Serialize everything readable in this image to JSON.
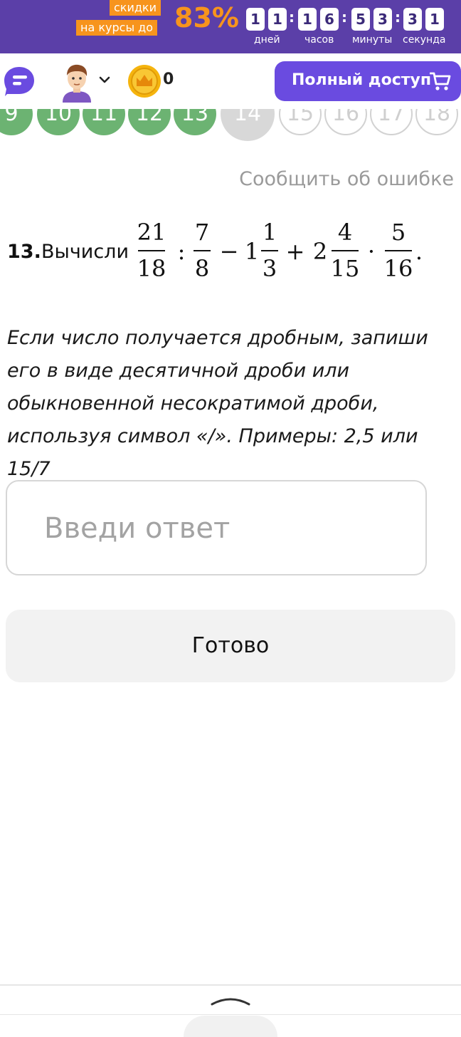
{
  "promo": {
    "label_line1": "скидки",
    "label_line2": "на курсы до",
    "percent": "83%",
    "timer": {
      "days": [
        "1",
        "1"
      ],
      "hours": [
        "1",
        "6"
      ],
      "minutes": [
        "5",
        "3"
      ],
      "seconds": [
        "3",
        "1"
      ],
      "separator": ":",
      "unit_days": "дней",
      "unit_hours": "часов",
      "unit_minutes": "минуты",
      "unit_seconds": "секунда"
    }
  },
  "header": {
    "coins": "0",
    "access_button": "Полный доступ",
    "icons": [
      "chat-icon",
      "avatar",
      "chevron-down-icon",
      "coin-icon",
      "cart-icon"
    ]
  },
  "pager": {
    "pages": [
      "9",
      "10",
      "11",
      "12",
      "13",
      "14",
      "15",
      "16",
      "17",
      "18"
    ],
    "done": [
      "9",
      "10",
      "11",
      "12",
      "13"
    ],
    "current": "14",
    "todo": [
      "15",
      "16",
      "17",
      "18"
    ]
  },
  "task": {
    "report_link": "Сообщить об ошибке",
    "number": "13.",
    "verb": "Вычисли",
    "expression": {
      "frac1": {
        "num": "21",
        "den": "18"
      },
      "op1": ":",
      "frac2": {
        "num": "7",
        "den": "8"
      },
      "op2": "−",
      "mixed1": {
        "whole": "1",
        "num": "1",
        "den": "3"
      },
      "op3": "+",
      "mixed2": {
        "whole": "2",
        "num": "4",
        "den": "15"
      },
      "op4": "·",
      "frac3": {
        "num": "5",
        "den": "16"
      },
      "end": "."
    },
    "hint": "Если число получается дробным, запиши его в виде десятичной дроби или обыкновенной несократимой дроби, используя символ «/». Примеры: 2,5 или 15/7",
    "answer_placeholder": "Введи ответ",
    "answer_value": "",
    "submit_button": "Готово"
  },
  "colors": {
    "promo_bg": "#5b3fa8",
    "promo_accent": "#f7941d",
    "access_button": "#6a4be0",
    "page_done": "#6cb372",
    "page_current": "#d8d8d8",
    "coin": "#f5b40e"
  }
}
